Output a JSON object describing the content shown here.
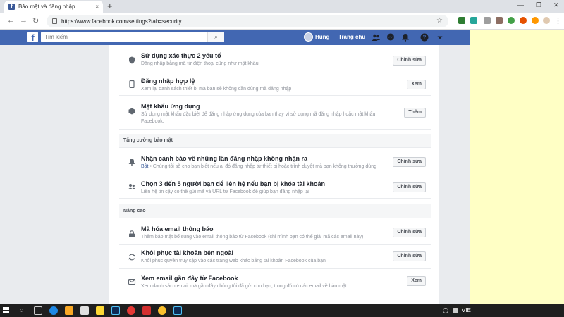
{
  "browser": {
    "tab_title": "Bảo mật và đăng nhập",
    "tab_close": "×",
    "new_tab": "+",
    "url": "https://www.facebook.com/settings?tab=security",
    "minimize": "—",
    "maximize": "❐",
    "close": "✕",
    "back": "←",
    "forward": "→",
    "reload": "↻",
    "star": "☆",
    "menu": "⋮"
  },
  "fb": {
    "logo": "f",
    "search_placeholder": "Tìm kiếm",
    "search_icon": "⌕",
    "user_name": "Hùng",
    "home": "Trang chủ"
  },
  "sections": {
    "login_rows": [
      {
        "title": "Sử dụng xác thực 2 yếu tố",
        "desc": "Đăng nhập bằng mã từ điện thoại cũng như mật khẩu",
        "button": "Chỉnh sửa",
        "icon": "shield-icon"
      },
      {
        "title": "Đăng nhập hợp lệ",
        "desc": "Xem lại danh sách thiết bị mà bạn sẽ không cần dùng mã đăng nhập",
        "button": "Xem",
        "icon": "phone-icon"
      },
      {
        "title": "Mật khẩu ứng dụng",
        "desc": "Sử dụng mật khẩu đặc biệt để đăng nhập ứng dụng của bạn thay vì sử dụng mã đăng nhập hoặc mật khẩu",
        "desc2": "Facebook.",
        "button": "Thêm",
        "icon": "cube-icon"
      }
    ],
    "enhanced_title": "Tăng cường bảo mật",
    "enhanced_rows": [
      {
        "title": "Nhận cảnh báo về những lần đăng nhập không nhận ra",
        "desc_link": "Bật",
        "desc": " • Chúng tôi sẽ cho bạn biết nếu ai đó đăng nhập từ thiết bị hoặc trình duyệt mà bạn không thường dùng",
        "button": "Chỉnh sửa",
        "icon": "bell-icon"
      },
      {
        "title": "Chọn 3 đến 5 người bạn để liên hệ nếu bạn bị khóa tài khoản",
        "desc": "Liên hệ tin cậy có thể gửi mã và URL từ Facebook để giúp bạn đăng nhập lại",
        "button": "Chỉnh sửa",
        "icon": "friends-icon"
      }
    ],
    "advanced_title": "Nâng cao",
    "advanced_rows": [
      {
        "title": "Mã hóa email thông báo",
        "desc": "Thêm bảo mật bổ sung vào email thông báo từ Facebook (chỉ mình bạn có thể giải mã các email này)",
        "button": "Chỉnh sửa",
        "icon": "lock-icon"
      },
      {
        "title": "Khôi phục tài khoản bên ngoài",
        "desc": "Khôi phục quyền truy cập vào các trang web khác bằng tài khoản Facebook của bạn",
        "button": "Chỉnh sửa",
        "icon": "recover-icon"
      },
      {
        "title": "Xem email gần đây từ Facebook",
        "desc": "Xem danh sách email mà gần đây chúng tôi đã gửi cho bạn, trong đó có các email về bảo mật",
        "button": "Xem",
        "icon": "mail-icon"
      }
    ]
  },
  "taskbar": {
    "search_icon": "○",
    "lang": "VIE"
  }
}
